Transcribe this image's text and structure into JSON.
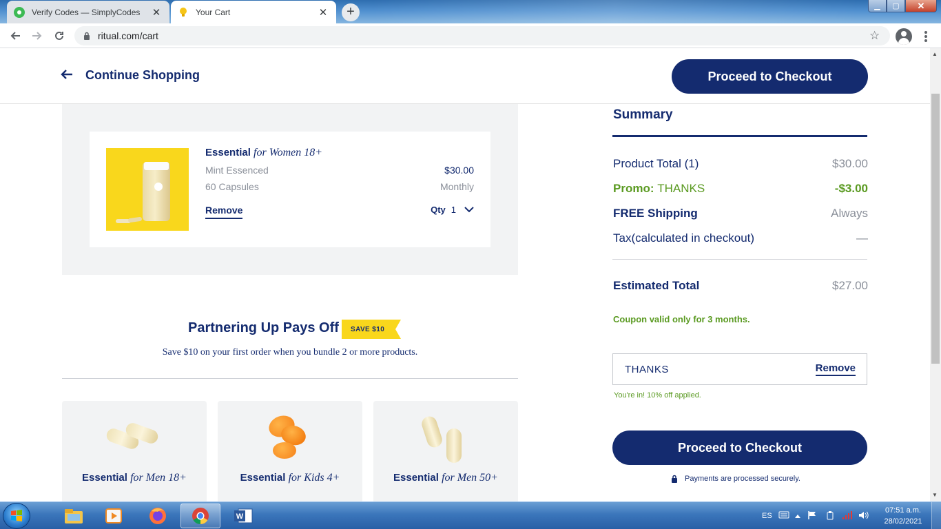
{
  "browser": {
    "tabs": [
      {
        "title": "Verify Codes — SimplyCodes",
        "active": false
      },
      {
        "title": "Your Cart",
        "active": true
      }
    ],
    "url": "ritual.com/cart"
  },
  "header": {
    "continue_label": "Continue Shopping",
    "checkout_label": "Proceed to Checkout"
  },
  "cart": {
    "item": {
      "name": "Essential",
      "name_suffix": "for Women 18+",
      "flavor": "Mint Essenced",
      "count": "60 Capsules",
      "remove_label": "Remove",
      "price": "$30.00",
      "frequency": "Monthly",
      "qty_label": "Qty",
      "qty_value": "1"
    }
  },
  "bundle": {
    "title": "Partnering Up Pays Off",
    "badge": "SAVE $10",
    "description": "Save $10 on your first order when you bundle 2 or more products.",
    "products": [
      {
        "name": "Essential",
        "suffix": "for Men 18+"
      },
      {
        "name": "Essential",
        "suffix": "for Kids 4+"
      },
      {
        "name": "Essential",
        "suffix": "for Men 50+"
      }
    ]
  },
  "summary": {
    "title": "Summary",
    "rows": [
      {
        "label": "Product Total (1)",
        "value": "$30.00"
      },
      {
        "label_prefix": "Promo: ",
        "label_code": "THANKS",
        "value": "-$3.00"
      },
      {
        "label": "FREE Shipping",
        "value": "Always"
      },
      {
        "label": "Tax(calculated in checkout)",
        "value": "—"
      }
    ],
    "estimated_label": "Estimated Total",
    "estimated_value": "$27.00",
    "coupon_note": "Coupon valid only for 3 months.",
    "coupon_code": "THANKS",
    "coupon_remove": "Remove",
    "applied_note": "You're in! 10% off applied.",
    "checkout_label": "Proceed to Checkout",
    "secure_note": "Payments are processed securely."
  },
  "taskbar": {
    "language": "ES",
    "time": "07:51 a.m.",
    "date": "28/02/2021"
  },
  "colors": {
    "navy": "#142b6f",
    "green": "#5a9a21",
    "yellow": "#f9d71c",
    "panel": "#f2f3f4"
  }
}
